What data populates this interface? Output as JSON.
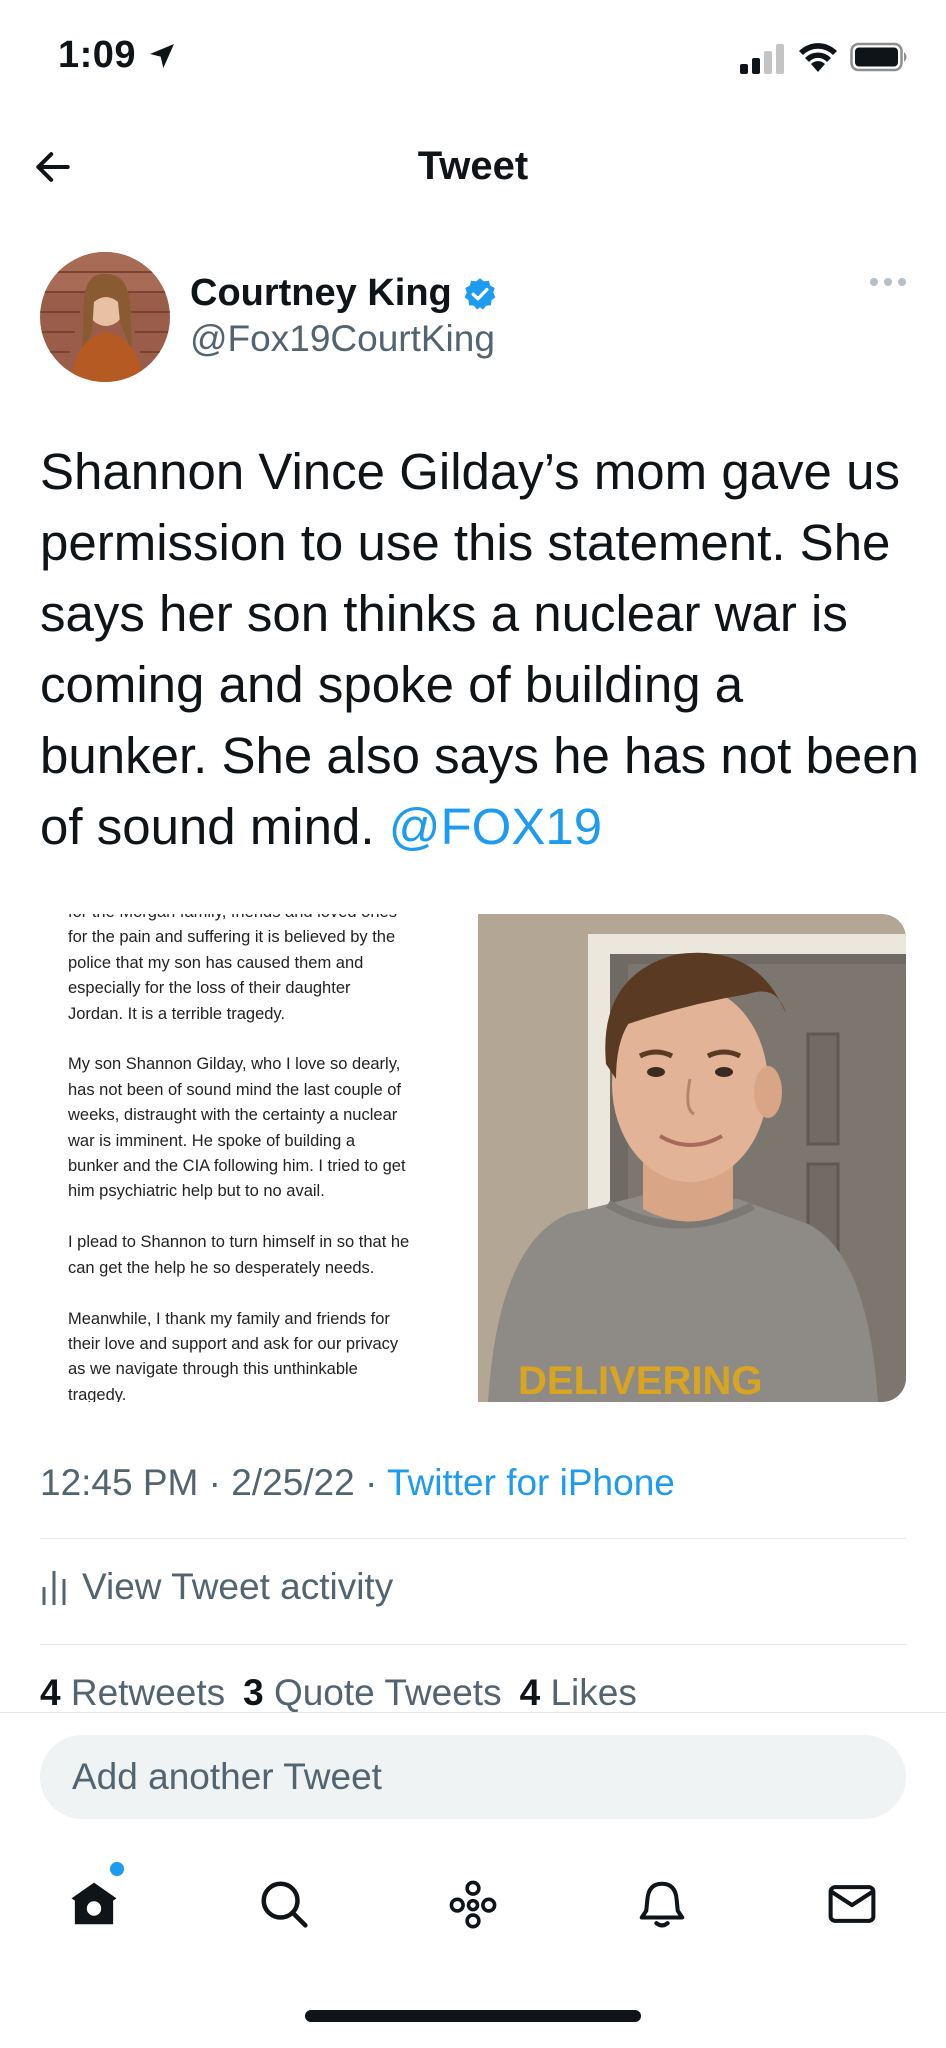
{
  "status_bar": {
    "time": "1:09"
  },
  "header": {
    "title": "Tweet"
  },
  "author": {
    "name": "Courtney King",
    "handle": "@Fox19CourtKing",
    "verified": true
  },
  "tweet": {
    "text": "Shannon Vince Gilday’s mom gave us permission to use this statement. She says her son thinks a nuclear war is coming and spoke of building a bunker. She also says he has not been of sound mind.",
    "mention": "@FOX19",
    "media_statement": "for the Morgan family, friends and loved ones\nfor the pain and suffering it is believed by the\npolice that my son has caused them and\nespecially for the loss of their daughter\nJordan.  It is a terrible tragedy.\n\nMy son Shannon Gilday, who I love so dearly,\nhas not been of sound mind the last couple of\nweeks, distraught with the certainty a nuclear\nwar is imminent.  He spoke of building a\nbunker and the CIA following him.  I tried to get\nhim psychiatric help but to no avail.\n\nI plead to Shannon to turn himself in so that he\ncan get the help he so desperately needs.\n\nMeanwhile, I thank my family and friends for\ntheir love and support and ask for our privacy\nas we navigate through this unthinkable\ntragedy.",
    "photo_shirt_text": "DELIVERING"
  },
  "meta": {
    "time": "12:45 PM",
    "date": "2/25/22",
    "separator": "·",
    "source": "Twitter for iPhone"
  },
  "activity_label": "View Tweet activity",
  "stats": {
    "retweets_count": "4",
    "retweets_label": "Retweets",
    "quotes_count": "3",
    "quotes_label": "Quote Tweets",
    "likes_count": "4",
    "likes_label": "Likes"
  },
  "reply": {
    "placeholder": "Add another Tweet"
  },
  "nav": [
    "home-icon",
    "search-icon",
    "spaces-icon",
    "notifications-icon",
    "messages-icon"
  ],
  "colors": {
    "accent": "#1d9bf0",
    "secondary_text": "#536471"
  }
}
